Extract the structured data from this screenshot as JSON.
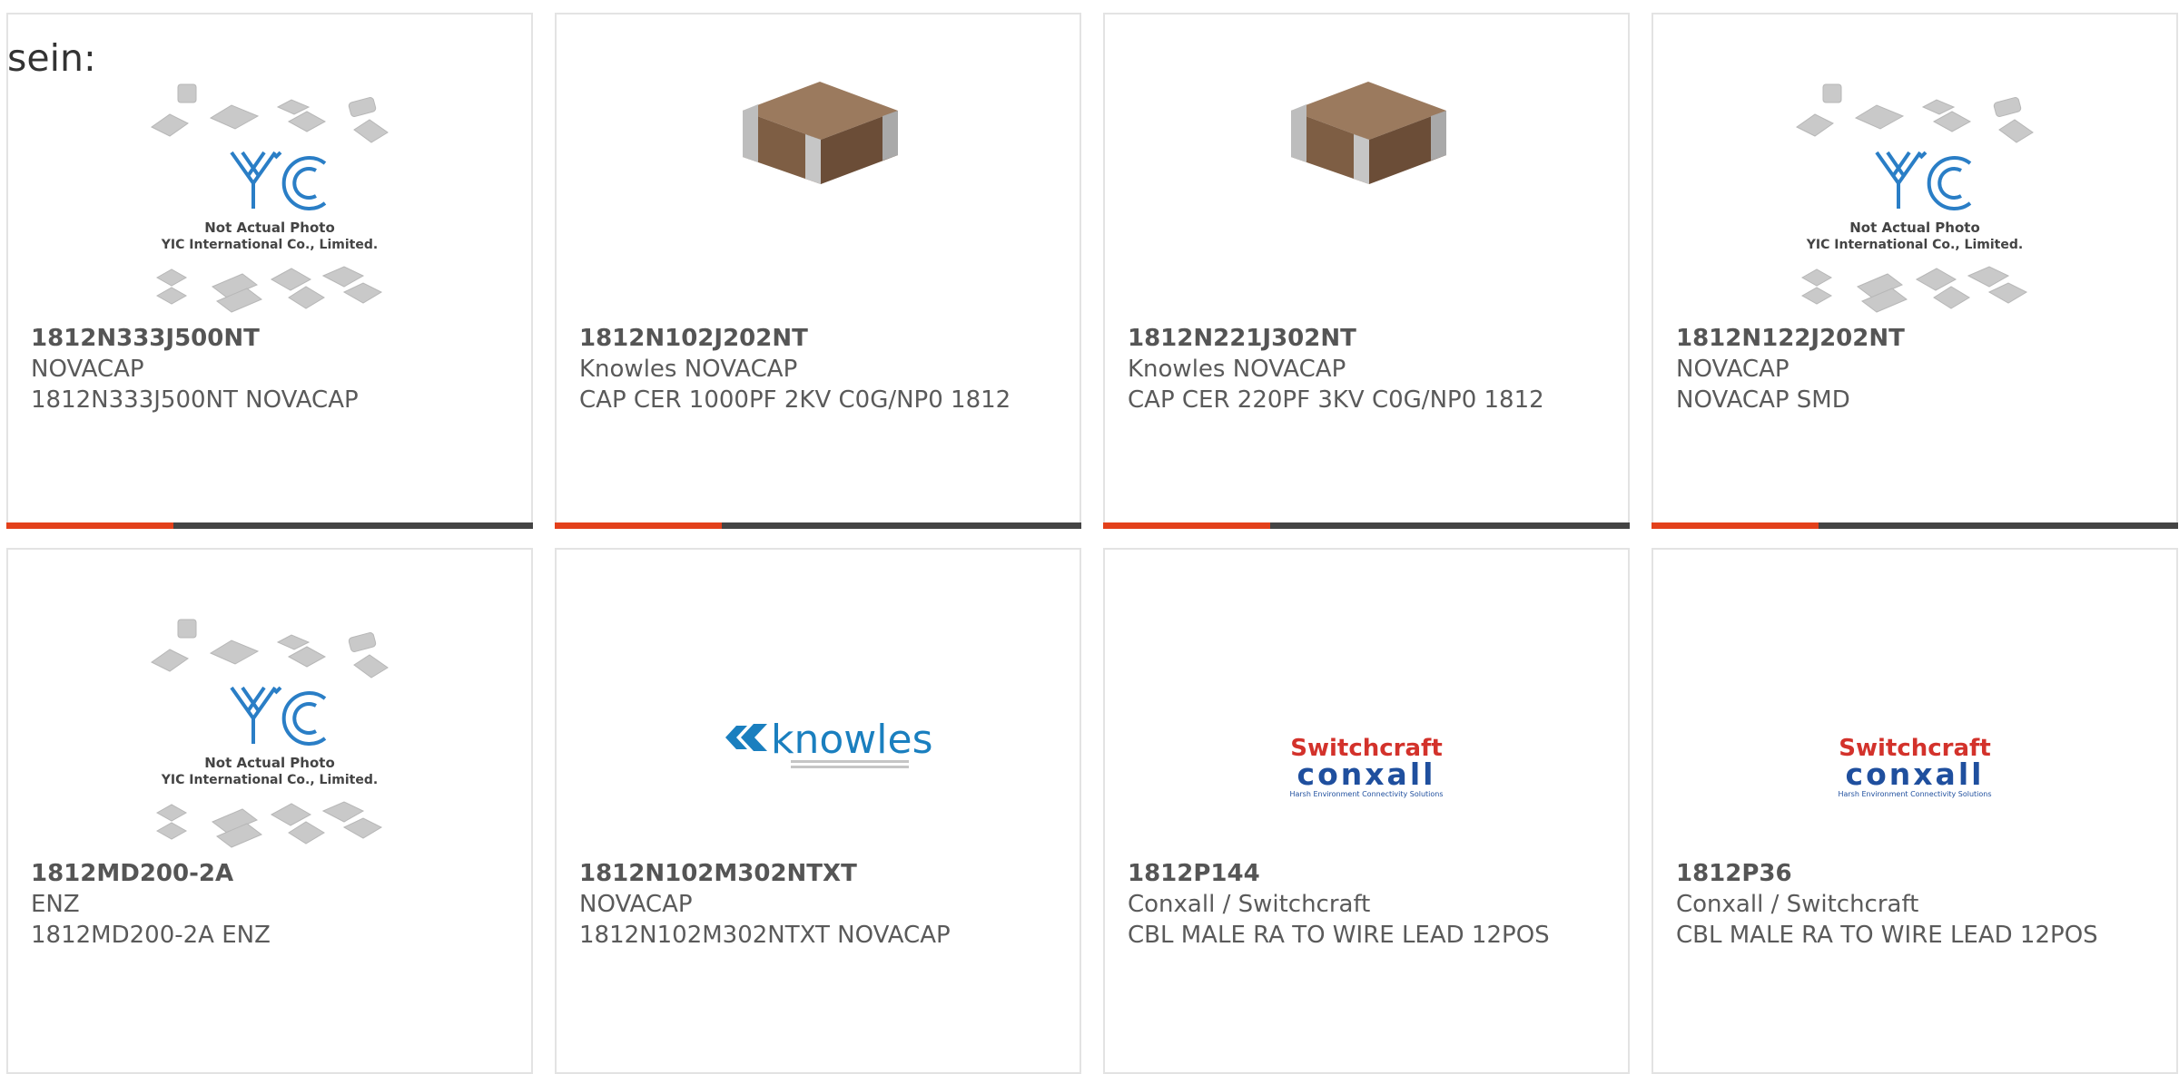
{
  "lead_text": "sein:",
  "colors": {
    "accent": "#e3401b",
    "bar": "#444444",
    "border": "#e3e3e3",
    "yic_blue": "#2a7ec6",
    "switchcraft_red": "#d3322b",
    "conxall_blue": "#1f4f9e",
    "knowles_blue": "#1a7fbf"
  },
  "placeholder": {
    "line1": "Not Actual Photo",
    "line2": "YIC International Co., Limited."
  },
  "knowles": {
    "name": "knowles"
  },
  "switchcraft": {
    "brand": "Switchcraft",
    "sub": "conxall",
    "tag": "Harsh Environment Connectivity Solutions"
  },
  "products": [
    {
      "part": "1812N333J500NT",
      "maker": "NOVACAP",
      "desc": "1812N333J500NT NOVACAP",
      "image": "placeholder"
    },
    {
      "part": "1812N102J202NT",
      "maker": "Knowles NOVACAP",
      "desc": "CAP CER 1000PF 2KV C0G/NP0 1812",
      "image": "chip"
    },
    {
      "part": "1812N221J302NT",
      "maker": "Knowles NOVACAP",
      "desc": "CAP CER 220PF 3KV C0G/NP0 1812",
      "image": "chip"
    },
    {
      "part": "1812N122J202NT",
      "maker": "NOVACAP",
      "desc": "NOVACAP SMD",
      "image": "placeholder"
    },
    {
      "part": "1812MD200-2A",
      "maker": "ENZ",
      "desc": "1812MD200-2A ENZ",
      "image": "placeholder"
    },
    {
      "part": "1812N102M302NTXT",
      "maker": "NOVACAP",
      "desc": "1812N102M302NTXT NOVACAP",
      "image": "knowles"
    },
    {
      "part": "1812P144",
      "maker": "Conxall / Switchcraft",
      "desc": "CBL MALE RA TO WIRE LEAD 12POS",
      "image": "switchcraft"
    },
    {
      "part": "1812P36",
      "maker": "Conxall / Switchcraft",
      "desc": "CBL MALE RA TO WIRE LEAD 12POS",
      "image": "switchcraft"
    }
  ]
}
